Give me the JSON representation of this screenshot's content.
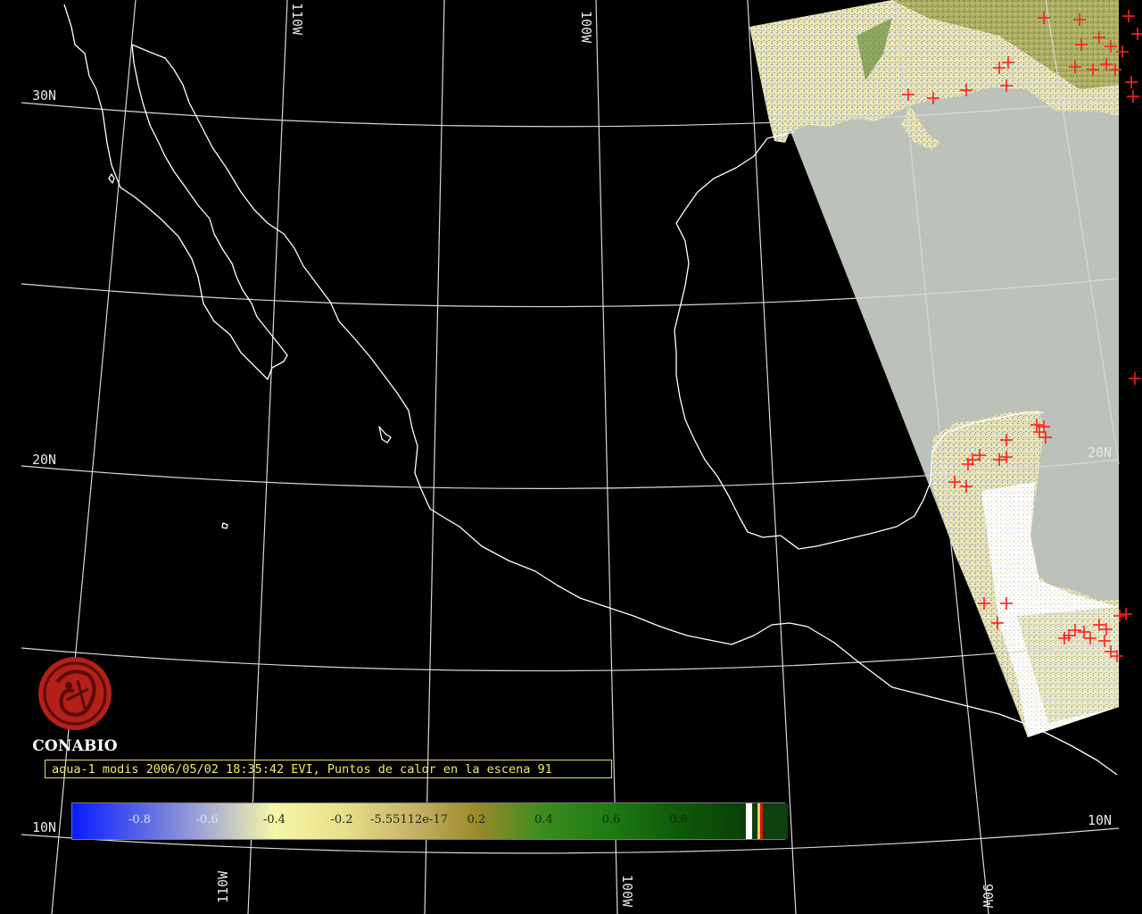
{
  "map": {
    "graticule_labels": {
      "lat_30n_left": "30N",
      "lat_20n_left": "20N",
      "lat_10n_left": "10N",
      "lat_20n_right": "20N",
      "lat_10n_right": "10N",
      "lon_110w_top": "110W",
      "lon_100w_top": "100W",
      "lon_110w_bottom": "110W",
      "lon_100w_bottom": "100W",
      "lon_90w_bottom": "90W"
    },
    "fire_marker_color": "#ff1e1e",
    "ocean_color": "#bcc1b9",
    "land_colors": [
      "#e9e5b2",
      "#c9c27a",
      "#6b8d3b",
      "#9aa5d8",
      "#ffffff"
    ]
  },
  "logo": {
    "name": "CONABIO",
    "color": "#b22018"
  },
  "caption": {
    "text": "aqua-1 modis 2006/05/02 18:35:42 EVI, Puntos de calor en la escena 91"
  },
  "colorbar": {
    "ticks": [
      "-0.8",
      "-0.6",
      "-0.4",
      "-0.2",
      "-5.55112e-17",
      "0.2",
      "0.4",
      "0.6",
      "0.8"
    ],
    "tick_values": [
      -0.8,
      -0.6,
      -0.4,
      -0.2,
      0.0,
      0.2,
      0.4,
      0.6,
      0.8
    ],
    "range": [
      -1.0,
      1.0
    ],
    "stops": [
      {
        "value": -1.0,
        "color": "#0a1cff"
      },
      {
        "value": -0.8,
        "color": "#5562e6"
      },
      {
        "value": -0.6,
        "color": "#a7acd2"
      },
      {
        "value": -0.4,
        "color": "#f6f6a8"
      },
      {
        "value": -0.2,
        "color": "#e8e18a"
      },
      {
        "value": 0.0,
        "color": "#c9b56a"
      },
      {
        "value": 0.2,
        "color": "#9c8a2a"
      },
      {
        "value": 0.4,
        "color": "#3a8c1e"
      },
      {
        "value": 0.6,
        "color": "#1f7a12"
      },
      {
        "value": 0.8,
        "color": "#0e5a0a"
      },
      {
        "value": 1.0,
        "color": "#0a3f08"
      }
    ],
    "class_swatches": [
      "#ffffff",
      "#0e3f0e",
      "#e8d14a",
      "#d01818",
      "#0e3f0e"
    ]
  }
}
